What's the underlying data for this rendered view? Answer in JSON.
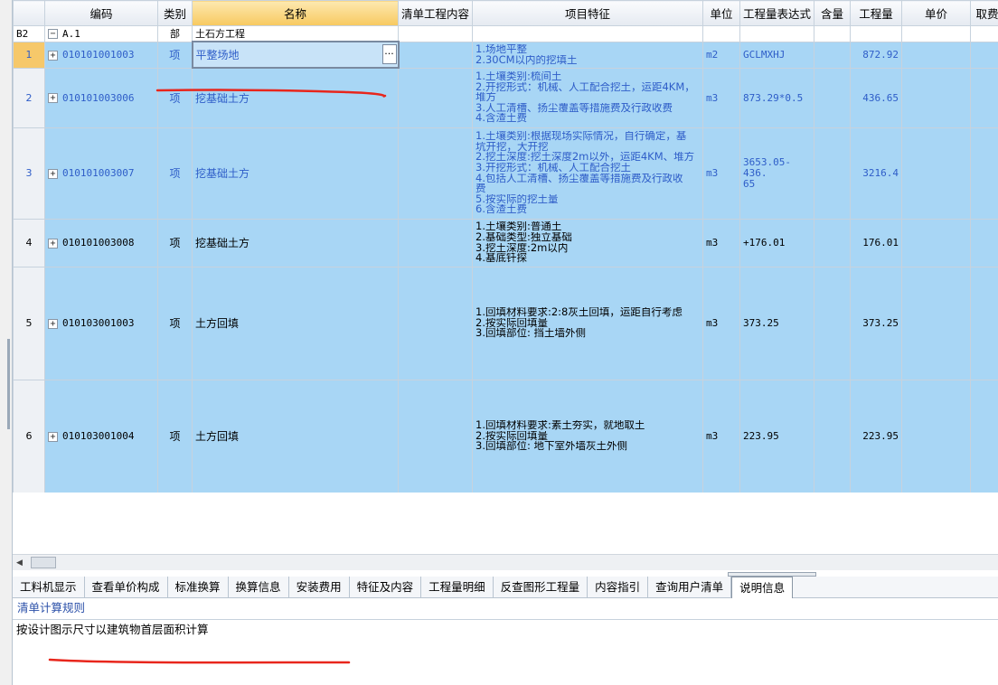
{
  "columns": {
    "idx": "",
    "code": "编码",
    "type": "类别",
    "name": "名称",
    "content": "清单工程内容",
    "features": "项目特征",
    "unit": "单位",
    "expr": "工程量表达式",
    "content_qty": "含量",
    "qty": "工程量",
    "price": "单价",
    "fee": "取费"
  },
  "section": {
    "idx": "B2",
    "code": "A.1",
    "type": "部",
    "name": "土石方工程"
  },
  "rows": [
    {
      "idx": "1",
      "code": "010101001003",
      "type": "项",
      "name": "平整场地",
      "features": [
        "1.场地平整",
        "2.30CM以内的挖填土"
      ],
      "unit": "m2",
      "expr": "GCLMXHJ",
      "qty": "872.92"
    },
    {
      "idx": "2",
      "code": "010101003006",
      "type": "项",
      "name": "挖基础土方",
      "features": [
        "1.土壤类别:梳间土",
        "2.开挖形式：机械、人工配合挖土，运距4KM，",
        "堆方",
        "3.人工清槽、扬尘覆盖等措施费及行政收费",
        "4.含渣土费"
      ],
      "unit": "m3",
      "expr": "873.29*0.5",
      "qty": "436.65"
    },
    {
      "idx": "3",
      "code": "010101003007",
      "type": "项",
      "name": "挖基础土方",
      "features": [
        "1.土壤类别:根据现场实际情况，自行确定，基",
        "坑开挖，大开挖",
        "2.挖土深度:挖土深度2m以外，运距4KM、堆方",
        "3.开挖形式：机械、人工配合挖土",
        "4.包括人工清槽、扬尘覆盖等措施费及行政收",
        "费",
        "5.按实际的挖土量",
        "6.含渣土费"
      ],
      "unit": "m3",
      "expr": [
        "3653.05-436.",
        "65"
      ],
      "qty": "3216.4"
    },
    {
      "idx": "4",
      "code": "010101003008",
      "type": "项",
      "name": "挖基础土方",
      "features": [
        "1.土壤类别:普通土",
        "2.基础类型:独立基础",
        "3.挖土深度:2m以内",
        "4.基底钎探"
      ],
      "unit": "m3",
      "expr": "+176.01",
      "qty": "176.01"
    },
    {
      "idx": "5",
      "code": "010103001003",
      "type": "项",
      "name": "土方回填",
      "features": [
        "1.回填材料要求:2:8灰土回填，运距自行考虑",
        "2.按实际回填量",
        "3.回填部位: 挡土墙外侧"
      ],
      "unit": "m3",
      "expr": "373.25",
      "qty": "373.25"
    },
    {
      "idx": "6",
      "code": "010103001004",
      "type": "项",
      "name": "土方回填",
      "features": [
        "1.回填材料要求:素土夯实，就地取土",
        "2.按实际回填量",
        "3.回填部位: 地下室外墙灰土外侧"
      ],
      "unit": "m3",
      "expr": "223.95",
      "qty": "223.95"
    }
  ],
  "edit_button": "...",
  "tabs": [
    "工料机显示",
    "查看单价构成",
    "标准换算",
    "换算信息",
    "安装费用",
    "特征及内容",
    "工程量明细",
    "反查图形工程量",
    "内容指引",
    "查询用户清单",
    "说明信息"
  ],
  "active_tab": "说明信息",
  "rule_label": "清单计算规则",
  "rule_text": "按设计图示尺寸以建筑物首层面积计算",
  "colors": {
    "row_blue": "#a8d6f5",
    "link_blue": "#2e5dc8",
    "annotation_red": "#e8261c",
    "selected_row_idx": "#f6c86a"
  }
}
